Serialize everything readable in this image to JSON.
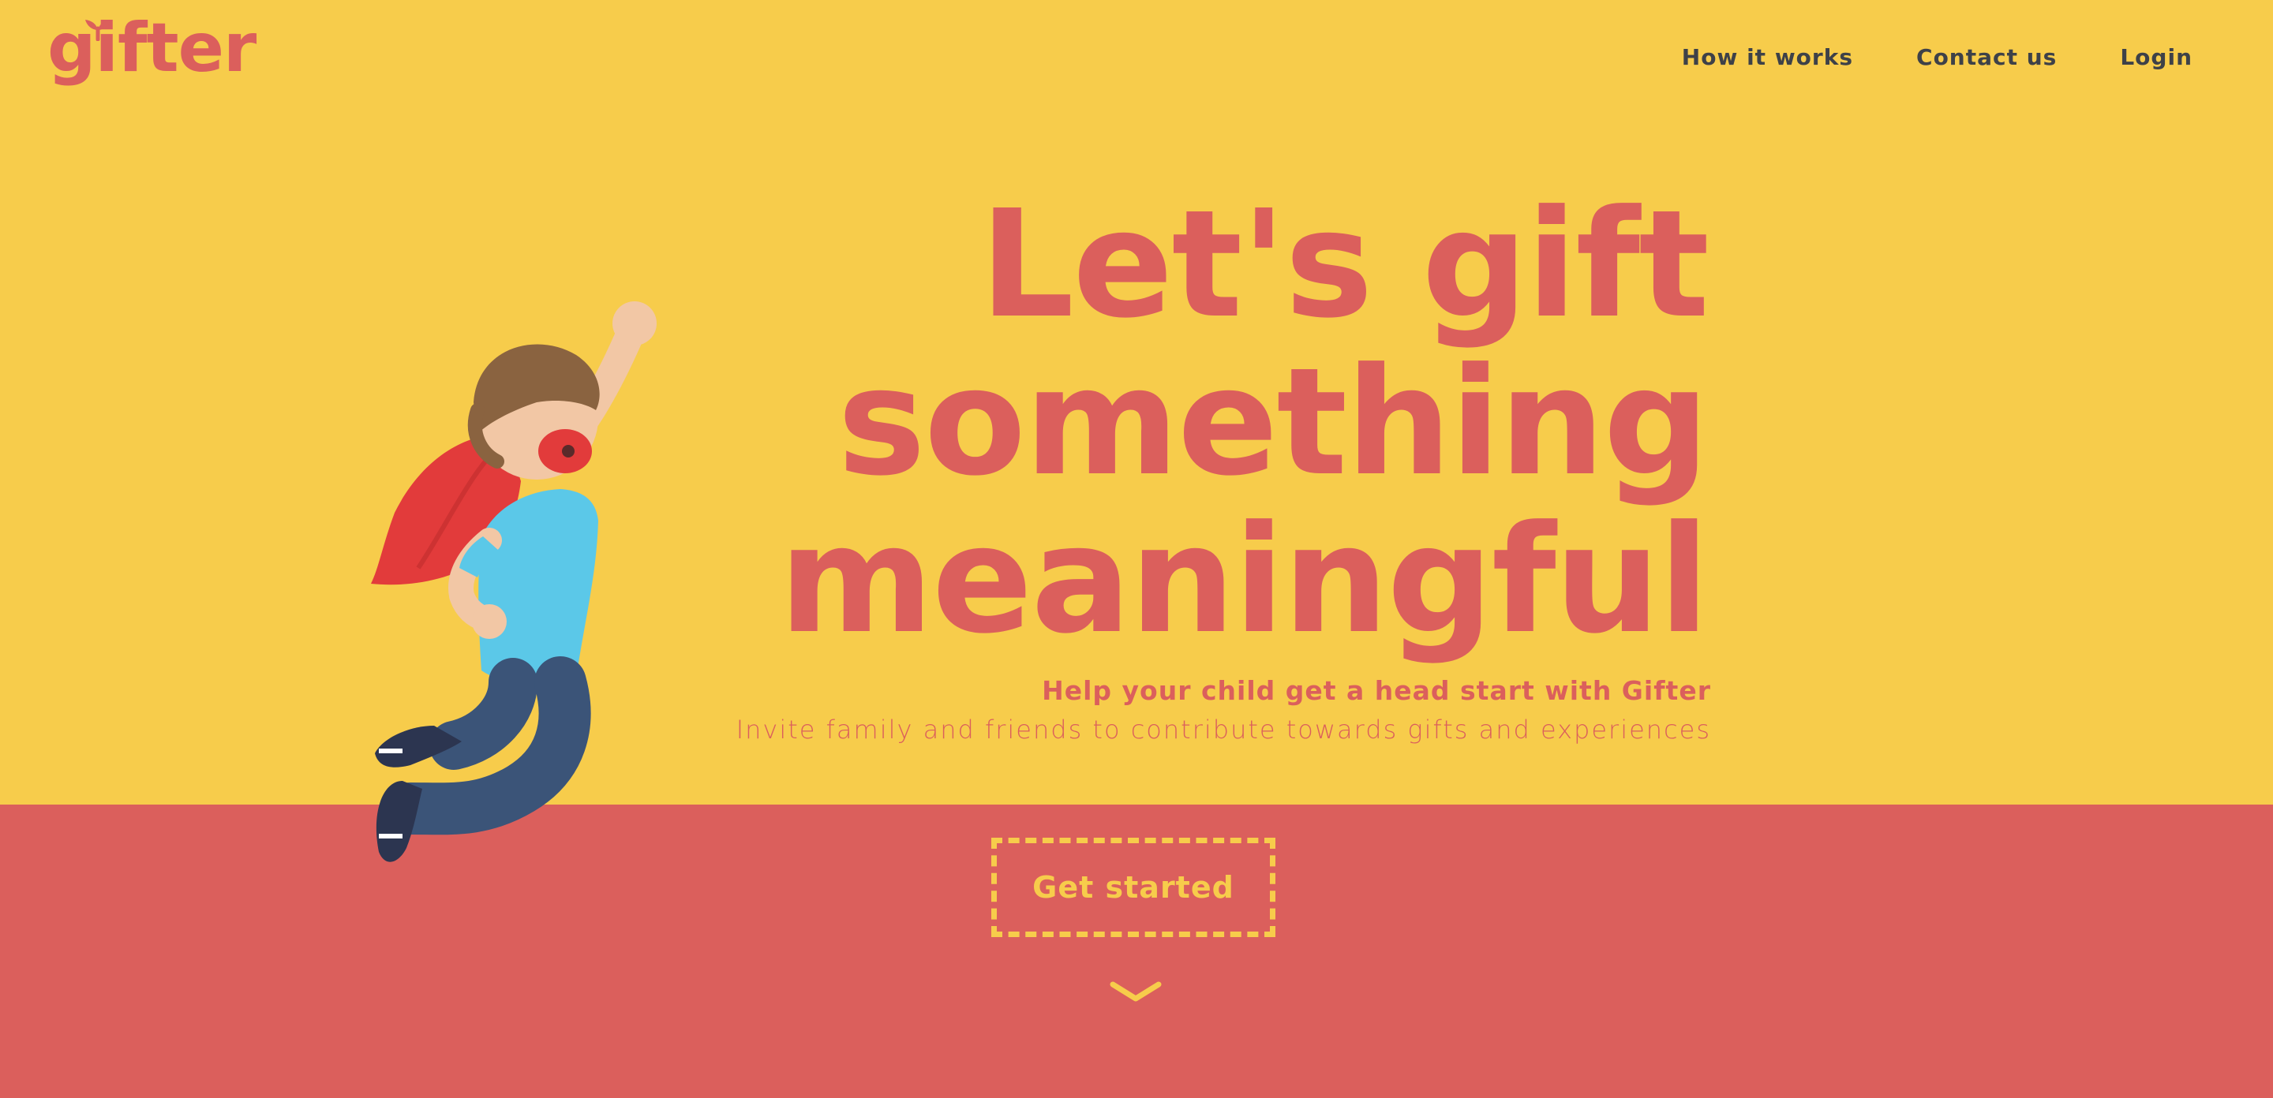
{
  "brand": {
    "name": "gifter",
    "colors": {
      "yellow": "#F7CC4B",
      "coral": "#DB5F5C",
      "navText": "#3E4148"
    }
  },
  "nav": {
    "items": [
      {
        "label": "How it works"
      },
      {
        "label": "Contact us"
      },
      {
        "label": "Login"
      }
    ]
  },
  "hero": {
    "headline": [
      "Let's gift",
      "something",
      "meaningful"
    ],
    "subhead": "Help your child get a head start with Gifter",
    "subtext": "Invite family and friends to contribute towards gifts and experiences",
    "cta_label": "Get started",
    "scroll_icon": "chevron-down-icon"
  },
  "illustration": {
    "icon": "superhero-kid-image"
  }
}
